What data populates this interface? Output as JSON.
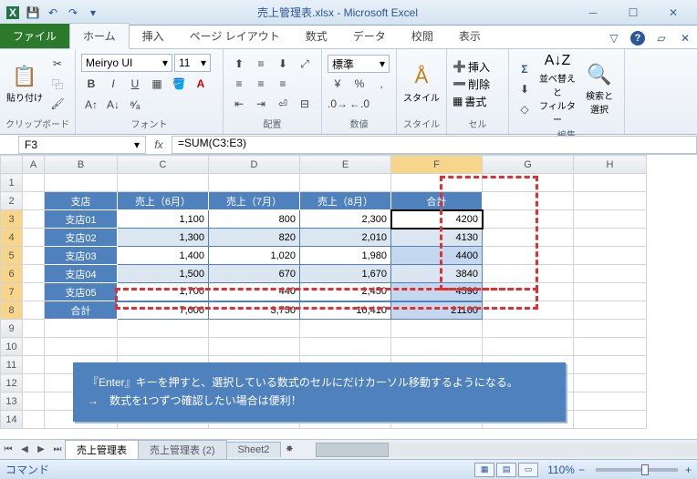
{
  "title": "売上管理表.xlsx - Microsoft Excel",
  "tabs": {
    "file": "ファイル",
    "home": "ホーム",
    "insert": "挿入",
    "layout": "ページ レイアウト",
    "formulas": "数式",
    "data": "データ",
    "review": "校閲",
    "view": "表示"
  },
  "ribbon": {
    "clipboard": {
      "label": "クリップボード",
      "paste": "貼り付け"
    },
    "font": {
      "label": "フォント",
      "family": "Meiryo UI",
      "size": "11"
    },
    "align": {
      "label": "配置"
    },
    "number": {
      "label": "数値",
      "format": "標準"
    },
    "styles": {
      "label": "スタイル",
      "btn": "スタイル"
    },
    "cells": {
      "label": "セル",
      "insert": "挿入",
      "delete": "削除",
      "format": "書式"
    },
    "editing": {
      "label": "編集",
      "sort": "並べ替えと\nフィルター",
      "find": "検索と\n選択"
    }
  },
  "namebox": "F3",
  "formula": "=SUM(C3:E3)",
  "cols": [
    "A",
    "B",
    "C",
    "D",
    "E",
    "F",
    "G",
    "H"
  ],
  "rows": [
    "1",
    "2",
    "3",
    "4",
    "5",
    "6",
    "7",
    "8",
    "9",
    "10",
    "11",
    "12",
    "13",
    "14"
  ],
  "chart_data": {
    "type": "table",
    "headers": [
      "支店",
      "売上（6月）",
      "売上（7月）",
      "売上（8月）",
      "合計"
    ],
    "rows": [
      [
        "支店01",
        "1,100",
        "800",
        "2,300",
        "4200"
      ],
      [
        "支店02",
        "1,300",
        "820",
        "2,010",
        "4130"
      ],
      [
        "支店03",
        "1,400",
        "1,020",
        "1,980",
        "4400"
      ],
      [
        "支店04",
        "1,500",
        "670",
        "1,670",
        "3840"
      ],
      [
        "支店05",
        "1,700",
        "440",
        "2,450",
        "4590"
      ],
      [
        "合計",
        "7,000",
        "3,750",
        "10,410",
        "21160"
      ]
    ]
  },
  "note": {
    "line1": "『Enter』キーを押すと、選択している数式のセルにだけカーソル移動するようになる。",
    "line2": "→　数式を1つずつ確認したい場合は便利！"
  },
  "sheets": [
    "売上管理表",
    "売上管理表 (2)",
    "Sheet2"
  ],
  "status": {
    "mode": "コマンド",
    "zoom": "110%"
  }
}
